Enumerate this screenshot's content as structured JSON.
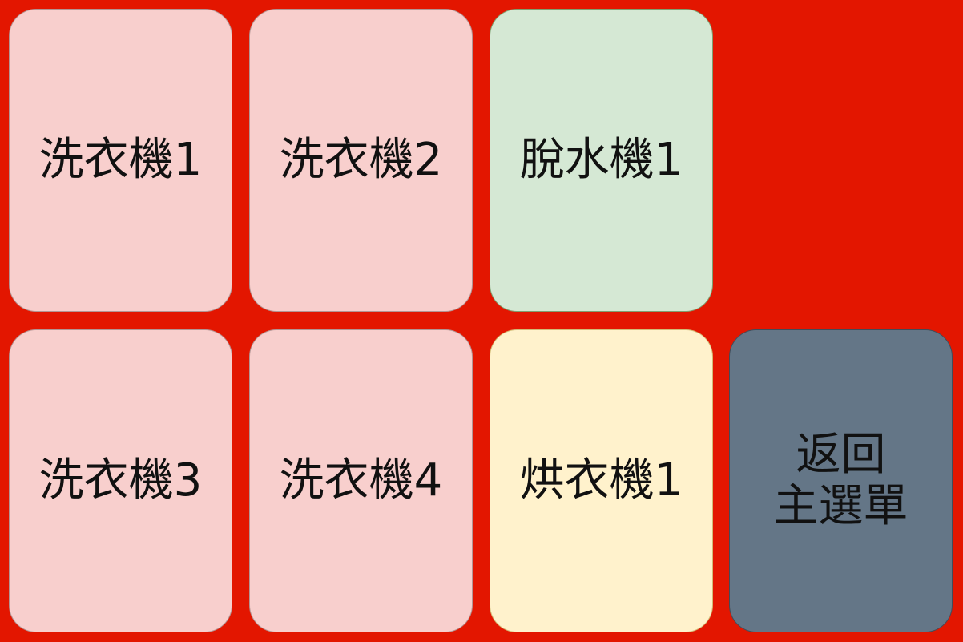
{
  "colors": {
    "background": "#e31600",
    "washer": "#f8cfcd",
    "spinner": "#d5e8d4",
    "dryer": "#fff2cc",
    "back": "#647687"
  },
  "tiles": {
    "washer1": "洗衣機1",
    "washer2": "洗衣機2",
    "spinner1": "脫水機1",
    "washer3": "洗衣機3",
    "washer4": "洗衣機4",
    "dryer1": "烘衣機1",
    "back": "返回\n主選單"
  }
}
